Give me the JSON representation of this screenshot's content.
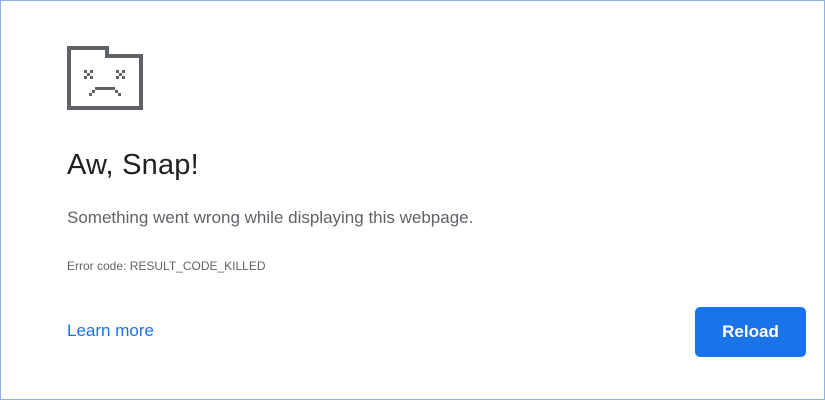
{
  "icon": "sad-folder-icon",
  "colors": {
    "accent": "#1a73e8",
    "title": "#202124",
    "secondary_text": "#5f6368",
    "icon": "#5f6368",
    "frame_border": "#8cb4dc"
  },
  "error": {
    "title": "Aw, Snap!",
    "message": "Something went wrong while displaying this webpage.",
    "code_text": "Error code: RESULT_CODE_KILLED"
  },
  "actions": {
    "learn_more_label": "Learn more",
    "reload_label": "Reload"
  }
}
